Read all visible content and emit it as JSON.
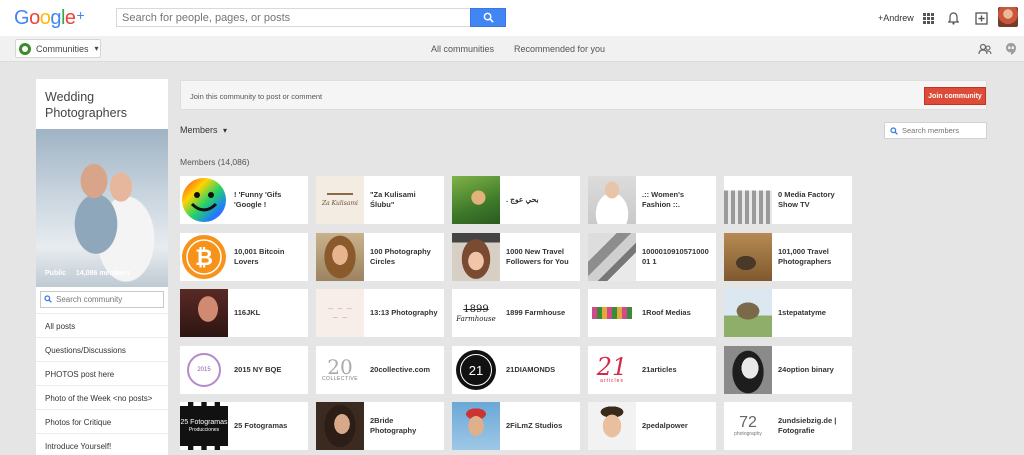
{
  "topbar": {
    "logo": "Google",
    "logo_plus": "+",
    "search_placeholder": "Search for people, pages, or posts",
    "user_name": "+Andrew",
    "icons": [
      "apps-grid-icon",
      "notifications-bell-icon",
      "share-add-icon",
      "profile-avatar"
    ]
  },
  "subbar": {
    "communities_label": "Communities",
    "tabs": [
      "All communities",
      "Recommended for you"
    ],
    "icons": [
      "community-people-icon",
      "hangouts-icon"
    ]
  },
  "community": {
    "title": "Wedding Photographers",
    "visibility": "Public",
    "member_count_label": "14,086 members",
    "search_placeholder": "Search community",
    "categories": [
      "All posts",
      "Questions/Discussions",
      "PHOTOS post here",
      "Photo of the Week <no posts>",
      "Photos for Critique",
      "Introduce Yourself!"
    ]
  },
  "main": {
    "join_text": "Join this community to post or comment",
    "join_button": "Join community",
    "members_dropdown": "Members",
    "members_search_placeholder": "Search members",
    "members_count_label": "Members (14,086)",
    "members": [
      {
        "name": "! 'Funny 'Gifs 'Google !"
      },
      {
        "name": "\"Za Kulisami Ślubu\""
      },
      {
        "name": "بحي عوج ."
      },
      {
        "name": ".:: Women's Fashion ::."
      },
      {
        "name": "0 Media Factory Show TV"
      },
      {
        "name": "10,001 Bitcoin Lovers"
      },
      {
        "name": "100 Photography Circles"
      },
      {
        "name": "1000 New Travel Followers for You"
      },
      {
        "name": "100001091057100001 1"
      },
      {
        "name": "101,000 Travel Photographers"
      },
      {
        "name": "116JKL"
      },
      {
        "name": "13:13 Photography"
      },
      {
        "name": "1899 Farmhouse"
      },
      {
        "name": "1Roof Medias"
      },
      {
        "name": "1stepatatyme"
      },
      {
        "name": "2015 NY BQE"
      },
      {
        "name": "20collective.com"
      },
      {
        "name": "21DIAMONDS"
      },
      {
        "name": "21articles"
      },
      {
        "name": "24option binary"
      },
      {
        "name": "25 Fotogramas"
      },
      {
        "name": "2Bride Photography"
      },
      {
        "name": "2FiLmZ Studios"
      },
      {
        "name": "2pedalpower"
      },
      {
        "name": "2undsiebzig.de | Fotografie"
      }
    ]
  },
  "thumb_texts": {
    "farmhouse": "1899",
    "farmhouse_sub": "Farmhouse",
    "collective": "20",
    "collective_sub": "COLLECTIVE",
    "diamonds": "21",
    "articles": "21",
    "articles_sub": "articles",
    "fotogramas": "25 Fotogramas",
    "fotogramas_sub": "Producciones",
    "year2015": "2015",
    "siebzig": "72",
    "siebzig_sub": "photography"
  }
}
